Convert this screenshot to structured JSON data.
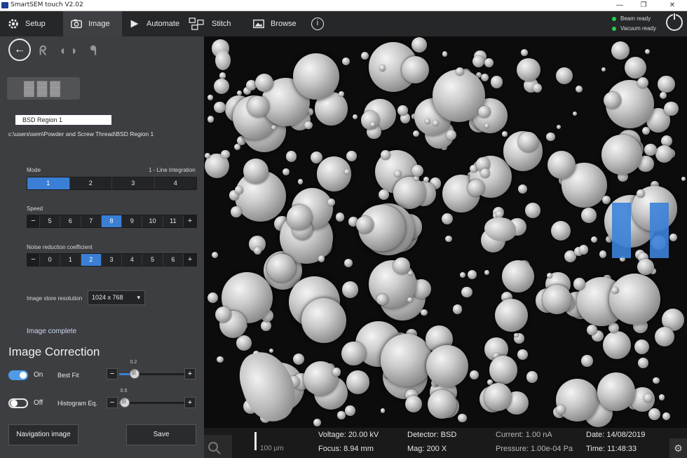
{
  "window": {
    "title": "SmartSEM touch V2.02",
    "minimize": "—",
    "restore": "❐",
    "close": "✕"
  },
  "toolbar": {
    "setup": "Setup",
    "image": "Image",
    "automate": "Automate",
    "stitch": "Stitch",
    "browse": "Browse",
    "info_icon": "i",
    "beam_status": "Beam ready",
    "vacuum_status": "Vacuum ready"
  },
  "panel": {
    "file_name": "BSD Region 1",
    "file_path": "c:\\users\\sem\\Powder and Screw Thread\\BSD Region 1",
    "mode": {
      "label": "Mode",
      "description": "1 - Line Integration",
      "options": [
        "1",
        "2",
        "3",
        "4"
      ],
      "selected": "1"
    },
    "speed": {
      "label": "Speed",
      "minus": "−",
      "plus": "+",
      "options": [
        "5",
        "6",
        "7",
        "8",
        "9",
        "10",
        "11"
      ],
      "selected": "8"
    },
    "noise": {
      "label": "Noise reduction coefficient",
      "minus": "−",
      "plus": "+",
      "options": [
        "0",
        "1",
        "2",
        "3",
        "4",
        "5",
        "6"
      ],
      "selected": "2"
    },
    "resolution": {
      "label": "Image store resolution",
      "value": "1024 x 768"
    },
    "image_status": "Image complete",
    "correction": {
      "heading": "Image Correction",
      "best_fit": {
        "state": "On",
        "label": "Best Fit",
        "value": "0.2",
        "fraction": 0.2
      },
      "histogram": {
        "state": "Off",
        "label": "Histogram Eq.",
        "value": "0.5",
        "fraction": 0.05
      }
    },
    "nav_button": "Navigation image",
    "save_button": "Save"
  },
  "info": {
    "voltage": "Voltage: 20.00 kV",
    "focus": "Focus: 8.94 mm",
    "detector": "Detector: BSD",
    "mag": "Mag: 200 X",
    "current": "Current: 1.00 nA",
    "pressure": "Pressure: 1.00e-04 Pa",
    "date": "Date: 14/08/2019",
    "time": "Time: 11:48:33",
    "scale": "100 µm"
  },
  "colors": {
    "accent": "#3a7fd5",
    "status_green": "#22d14a",
    "panel_bg": "#3d3e41"
  }
}
